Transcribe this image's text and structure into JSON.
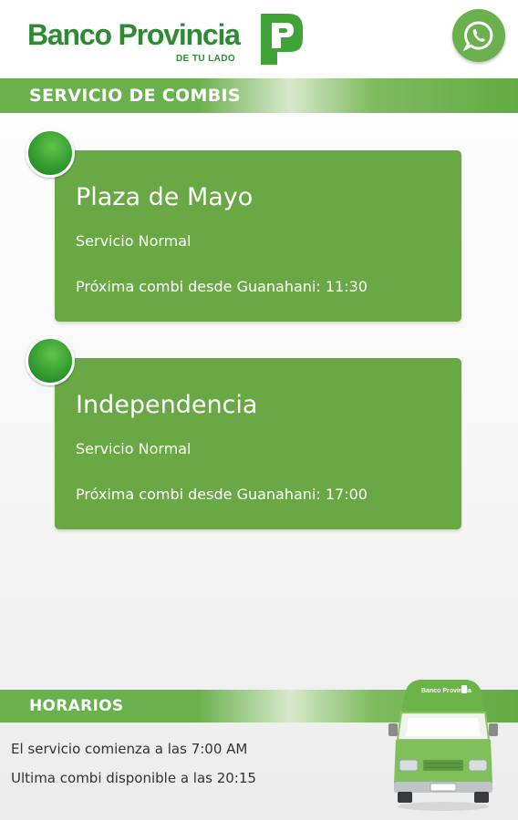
{
  "header": {
    "brand_name": "Banco Provincia",
    "brand_tagline": "DE TU LADO",
    "logo_icon": "banco-provincia-p-logo",
    "whatsapp_icon": "whatsapp-icon"
  },
  "section": {
    "title": "SERVICIO DE COMBIS"
  },
  "routes": [
    {
      "name": "Plaza de Mayo",
      "status": "Servicio Normal",
      "next": "Próxima combi desde Guanahani: 11:30"
    },
    {
      "name": "Independencia",
      "status": "Servicio Normal",
      "next": "Próxima combi desde Guanahani: 17:00"
    }
  ],
  "horarios": {
    "title": "HORARIOS",
    "start": "El servicio comienza a las 7:00 AM",
    "last": "Ultima combi disponible a las 20:15"
  },
  "van": {
    "brand_name": "Banco Provincia"
  },
  "colors": {
    "brand_green": "#2f8a35",
    "card_green": "#6aa845",
    "bar_green": "#6ab04c",
    "dot_green": "#2f9a2e"
  }
}
